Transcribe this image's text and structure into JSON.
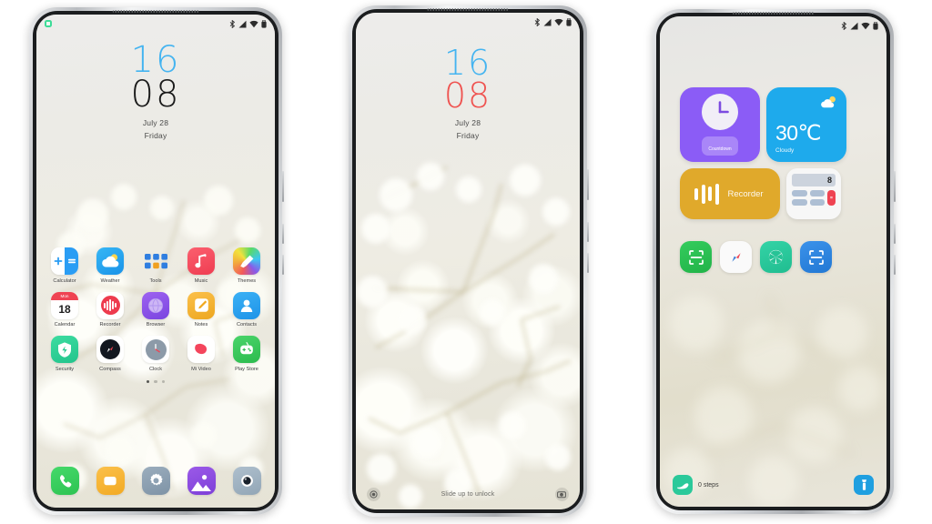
{
  "phones": [
    {
      "id": "phone-home",
      "type": "home-screen",
      "status_bar": {
        "privacy_indicator": "privacy-dot-icon",
        "icons": [
          "bluetooth-icon",
          "signal-icon",
          "wifi-icon",
          "battery-icon"
        ]
      },
      "clock": {
        "hours": "16",
        "minutes": "08",
        "hours_color": "#44b4f0",
        "minutes_color": "#1a1a1a",
        "date": "July 28",
        "weekday": "Friday"
      },
      "app_rows": [
        [
          {
            "label": "Calculator",
            "icon": "calculator-icon"
          },
          {
            "label": "Weather",
            "icon": "weather-icon"
          },
          {
            "label": "Tools",
            "icon": "tools-icon"
          },
          {
            "label": "Music",
            "icon": "music-icon"
          },
          {
            "label": "Themes",
            "icon": "themes-icon"
          }
        ],
        [
          {
            "label": "Calendar",
            "icon": "calendar-icon",
            "badge_top": "Mon",
            "badge_day": "18"
          },
          {
            "label": "Recorder",
            "icon": "recorder-icon"
          },
          {
            "label": "Browser",
            "icon": "browser-icon"
          },
          {
            "label": "Notes",
            "icon": "notes-icon"
          },
          {
            "label": "Contacts",
            "icon": "contacts-icon"
          }
        ],
        [
          {
            "label": "Security",
            "icon": "security-icon"
          },
          {
            "label": "Compass",
            "icon": "compass-icon"
          },
          {
            "label": "Clock",
            "icon": "clock-icon"
          },
          {
            "label": "Mi Video",
            "icon": "mi-video-icon"
          },
          {
            "label": "Play Store",
            "icon": "play-store-icon"
          }
        ]
      ],
      "page_dots": {
        "count": 3,
        "active_index": 0
      },
      "dock": [
        {
          "label": "Phone",
          "icon": "phone-icon"
        },
        {
          "label": "Messages",
          "icon": "messages-icon"
        },
        {
          "label": "Settings",
          "icon": "settings-gear-icon"
        },
        {
          "label": "Gallery",
          "icon": "gallery-icon"
        },
        {
          "label": "Camera",
          "icon": "camera-icon"
        }
      ]
    },
    {
      "id": "phone-lock",
      "type": "lock-screen",
      "status_bar": {
        "icons": [
          "bluetooth-icon",
          "signal-icon",
          "wifi-icon",
          "battery-icon"
        ]
      },
      "clock": {
        "hours": "16",
        "minutes": "08",
        "hours_color": "#44b4f0",
        "minutes_color": "#ef5350",
        "date": "July 28",
        "weekday": "Friday"
      },
      "bottom": {
        "left_shortcut": "torch-icon",
        "hint": "Slide up to unlock",
        "right_shortcut": "camera-icon"
      }
    },
    {
      "id": "phone-widgets",
      "type": "widget-screen",
      "status_bar": {
        "icons": [
          "bluetooth-icon",
          "signal-icon",
          "wifi-icon",
          "battery-icon"
        ]
      },
      "widgets": [
        {
          "name": "countdown-widget",
          "label": "Countdown",
          "icon": "analog-clock-icon",
          "color": "#8b5cf6"
        },
        {
          "name": "weather-widget",
          "temperature": "30℃",
          "condition": "Cloudy",
          "icon": "sun-cloud-icon",
          "color": "#1eaaec"
        },
        {
          "name": "recorder-widget",
          "label": "Recorder",
          "icon": "waveform-icon",
          "color": "#e0a92b"
        },
        {
          "name": "calculator-widget",
          "display_value": "8",
          "equals_label": "=",
          "color": "#f7f7f7"
        }
      ],
      "shortcuts": [
        {
          "name": "scan-code-shortcut",
          "icon": "scan-frame-icon",
          "color": "#2ebd54"
        },
        {
          "name": "compass-shortcut",
          "icon": "compass-needle-icon",
          "color": "#fafafa"
        },
        {
          "name": "camera-shortcut",
          "icon": "aperture-icon",
          "color": "#2bc99a"
        },
        {
          "name": "scan-document-shortcut",
          "icon": "scan-frame-icon",
          "color": "#2b84de"
        }
      ],
      "bottom": {
        "steps_label": "0 steps",
        "steps_icon": "shoe-icon",
        "torch_icon": "torch-icon"
      }
    }
  ]
}
